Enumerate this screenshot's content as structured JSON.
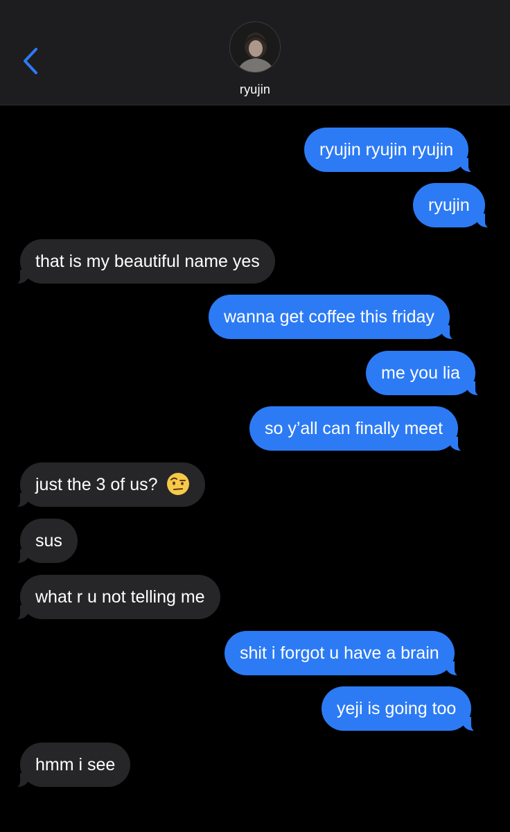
{
  "header": {
    "contact_name": "ryujin",
    "back_icon": "chevron-left-icon",
    "accent_color": "#2c7bf5"
  },
  "messages": [
    {
      "direction": "sent",
      "text": "ryujin ryujin ryujin"
    },
    {
      "direction": "sent",
      "text": "ryujin"
    },
    {
      "direction": "received",
      "text": "that is my beautiful name yes"
    },
    {
      "direction": "sent",
      "text": "wanna get coffee this friday"
    },
    {
      "direction": "sent",
      "text": "me you lia"
    },
    {
      "direction": "sent",
      "text": "so y’all can finally meet"
    },
    {
      "direction": "received",
      "text": "just the 3 of us?",
      "emoji": "raised-eyebrow-emoji"
    },
    {
      "direction": "received",
      "text": "sus"
    },
    {
      "direction": "received",
      "text": "what r u not telling me"
    },
    {
      "direction": "sent",
      "text": "shit i forgot u have a brain"
    },
    {
      "direction": "sent",
      "text": "yeji is going too"
    },
    {
      "direction": "received",
      "text": "hmm i see"
    }
  ],
  "colors": {
    "sent_bubble": "#2c7bf5",
    "received_bubble": "#262628",
    "background": "#000000",
    "header_background": "#1d1d1f"
  }
}
